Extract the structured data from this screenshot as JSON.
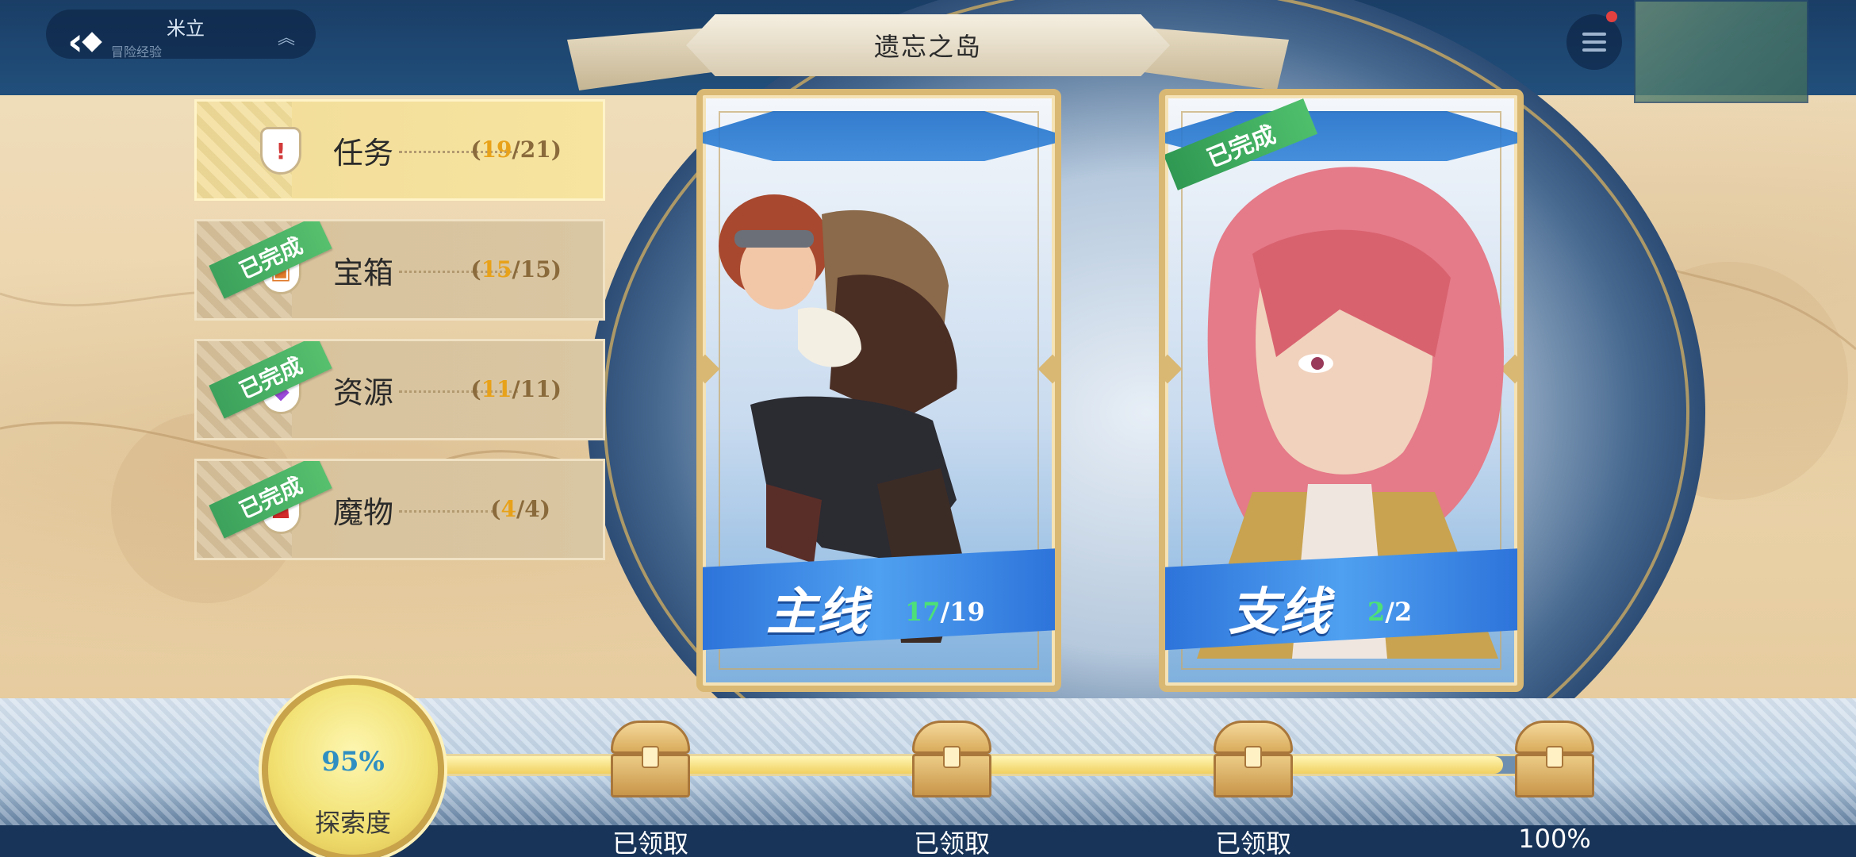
{
  "header": {
    "player_name": "米立",
    "player_sub": "冒险经验"
  },
  "title": "遗忘之岛",
  "categories": [
    {
      "label": "任务",
      "done": "19",
      "total": "/21",
      "open": "(",
      "close": ")",
      "icon": "exclamation-icon",
      "completed_badge": ""
    },
    {
      "label": "宝箱",
      "done": "15",
      "total": "/15",
      "open": "(",
      "close": ")",
      "icon": "chest-icon",
      "completed_badge": "已完成"
    },
    {
      "label": "资源",
      "done": "11",
      "total": "/11",
      "open": "(",
      "close": ")",
      "icon": "crystal-icon",
      "completed_badge": "已完成"
    },
    {
      "label": "魔物",
      "done": "4",
      "total": "/4",
      "open": "(",
      "close": ")",
      "icon": "monster-icon",
      "completed_badge": "已完成"
    }
  ],
  "cards": [
    {
      "label": "主线",
      "done": "17",
      "total": "/19",
      "completed_badge": ""
    },
    {
      "label": "支线",
      "done": "2",
      "total": "/2",
      "completed_badge": "已完成"
    }
  ],
  "progress": {
    "percent_text": "95%",
    "percent_value": 0.95,
    "label": "探索度",
    "milestones": [
      {
        "label": "已领取"
      },
      {
        "label": "已领取"
      },
      {
        "label": "已领取"
      },
      {
        "label": "100%"
      }
    ]
  },
  "colors": {
    "accent_gold": "#d9b873",
    "done_green": "#4de078",
    "badge_green": "#3ca25c",
    "count_orange": "#e8a21a"
  }
}
